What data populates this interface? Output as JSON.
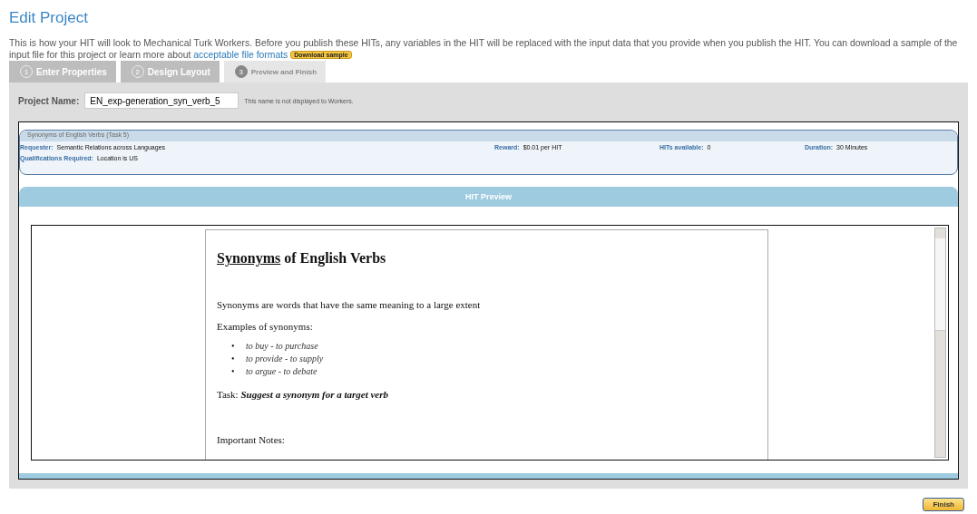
{
  "page_title": "Edit Project",
  "description": {
    "text": "This is how your HIT will look to Mechanical Turk Workers. Before you publish these HITs, any variables in the HIT will be replaced with the input data that you provide when you publish the HIT. You can download a sample of the input file for this project or learn more about",
    "link": "acceptable file formats",
    "button": "Download sample"
  },
  "tabs": [
    {
      "number": "1",
      "label": "Enter Properties",
      "selected": false
    },
    {
      "number": "2",
      "label": "Design Layout",
      "selected": false
    },
    {
      "number": "3",
      "label": "Preview and Finish",
      "selected": true
    }
  ],
  "project_name": {
    "label": "Project Name:",
    "value": "EN_exp-generation_syn_verb_5",
    "hint": "This name is not displayed to Workers."
  },
  "hit_info": {
    "title": "Synonyms of English Verbs (Task 5)",
    "fields": [
      {
        "label": "Requester:",
        "value": "Semantic Relations across Languages"
      },
      {
        "label": "Reward:",
        "value": "$0.01 per HIT"
      },
      {
        "label": "HITs available:",
        "value": "0"
      },
      {
        "label": "Duration:",
        "value": "30 Minutes"
      },
      {
        "label": "Qualifications Required:",
        "value": "Location is US"
      }
    ]
  },
  "preview_bar": "HIT Preview",
  "document": {
    "heading_underlined": "Synonyms",
    "heading_rest": " of English Verbs",
    "intro": "Synonyms are words that have the same meaning to a large extent",
    "examples_label": "Examples of synonyms:",
    "examples": [
      {
        "bullet": "•",
        "text": "to buy - to purchase"
      },
      {
        "bullet": "•",
        "text": "to provide - to supply"
      },
      {
        "bullet": "•",
        "text": "to argue - to debate"
      }
    ],
    "task": "Task: **Suggest a synonym for a target verb**",
    "notes_label": "Important Notes:"
  },
  "finish_button": "Finish"
}
